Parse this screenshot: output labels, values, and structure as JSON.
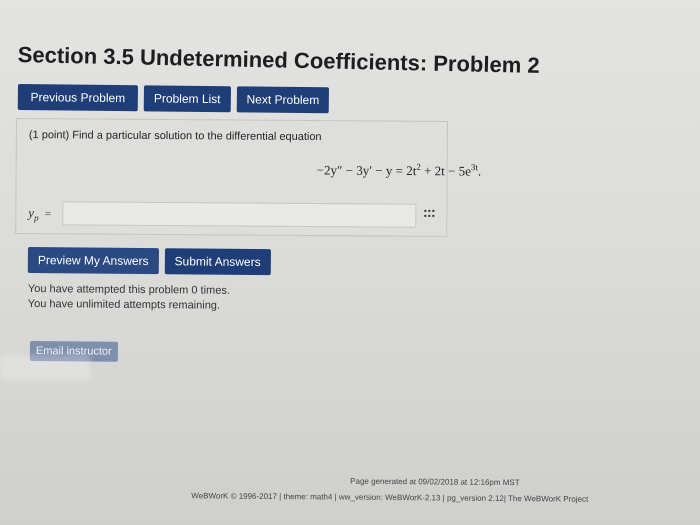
{
  "title": "Section 3.5 Undetermined Coefficients: Problem 2",
  "nav": {
    "previous": "Previous Problem",
    "list": "Problem List",
    "next": "Next Problem"
  },
  "problem": {
    "statement": "(1 point) Find a particular solution to the differential equation",
    "equation_lhs": "−2y″ − 3y′ − y = 2t",
    "equation_exp1": "2",
    "equation_mid": " + 2t − 5e",
    "equation_exp2": "3t",
    "equation_end": ".",
    "answer_label": "y",
    "answer_sub": "p",
    "answer_value": ""
  },
  "actions": {
    "preview": "Preview My Answers",
    "submit": "Submit Answers"
  },
  "attempts": {
    "line1": "You have attempted this problem 0 times.",
    "line2": "You have unlimited attempts remaining."
  },
  "email_label": "Email instructor",
  "footer": {
    "generated": "Page generated at 09/02/2018 at 12:16pm MST",
    "credits": "WeBWorK © 1996-2017 | theme: math4 | ww_version: WeBWorK-2.13 | pg_version 2.12| The WeBWorK Project"
  },
  "colors": {
    "button": "#1f3e77",
    "background": "#dcdcda"
  }
}
